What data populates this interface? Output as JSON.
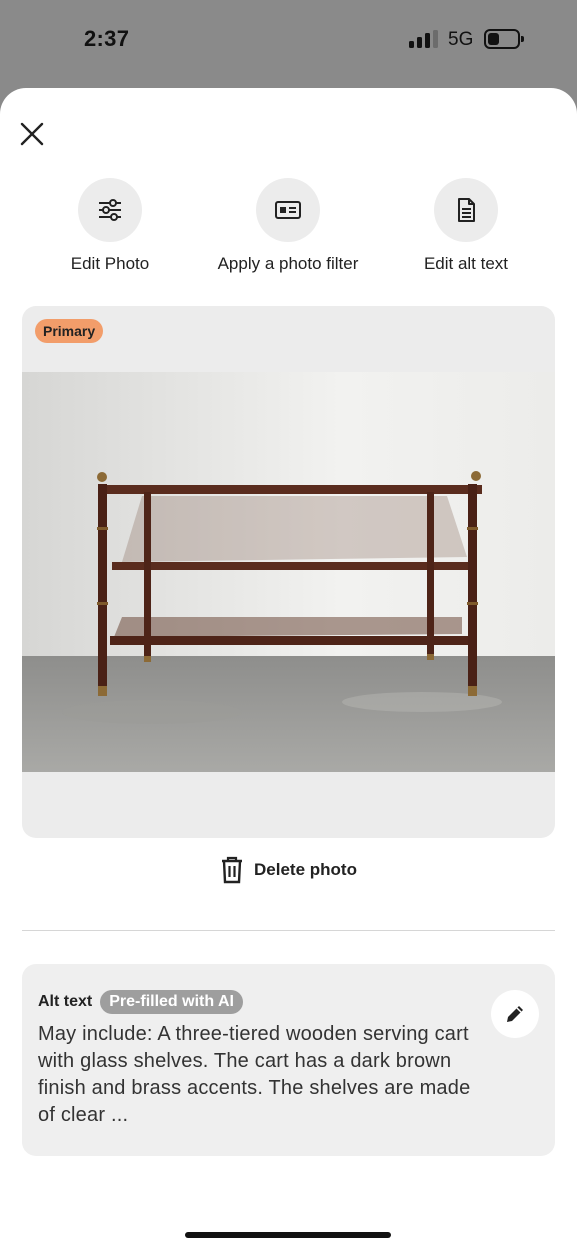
{
  "status_bar": {
    "time": "2:37",
    "network": "5G"
  },
  "actions": [
    {
      "label": "Edit Photo",
      "icon": "sliders-icon"
    },
    {
      "label": "Apply a photo filter",
      "icon": "photo-filter-icon"
    },
    {
      "label": "Edit alt text",
      "icon": "document-icon"
    }
  ],
  "photo": {
    "badge": "Primary",
    "badge_color": "#f29d6a"
  },
  "delete": {
    "label": "Delete photo",
    "icon": "trash-icon"
  },
  "alt_text": {
    "title": "Alt text",
    "badge": "Pre-filled with AI",
    "body": "May include: A three-tiered wooden serving cart with glass shelves. The cart has a dark brown finish and brass accents. The shelves are made of clear ...",
    "edit_icon": "pencil-icon"
  }
}
